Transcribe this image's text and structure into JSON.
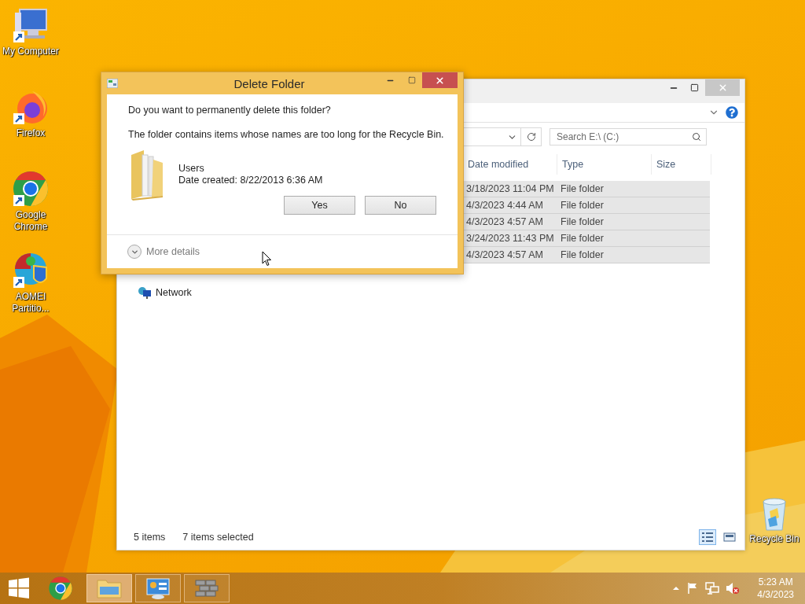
{
  "desktop_icons": [
    {
      "kind": "computer",
      "label": "My Computer"
    },
    {
      "kind": "firefox",
      "label": "Firefox"
    },
    {
      "kind": "chrome",
      "label": "Google Chrome"
    },
    {
      "kind": "aomei",
      "label": "AOMEI Partitio..."
    }
  ],
  "recycle_bin": {
    "label": "Recycle Bin"
  },
  "explorer": {
    "search": {
      "placeholder": "Search E:\\ (C:)"
    },
    "columns": [
      "Date modified",
      "Type",
      "Size"
    ],
    "rows": [
      {
        "date_modified": "3/18/2023 11:04 PM",
        "type": "File folder",
        "selected": true
      },
      {
        "date_modified": "4/3/2023 4:44 AM",
        "type": "File folder",
        "selected": true
      },
      {
        "date_modified": "4/3/2023 4:57 AM",
        "type": "File folder",
        "selected": true
      },
      {
        "date_modified": "3/24/2023 11:43 PM",
        "type": "File folder",
        "selected": true
      },
      {
        "date_modified": "4/3/2023 4:57 AM",
        "type": "File folder",
        "selected": true
      }
    ],
    "nav": [
      {
        "label": "Network"
      }
    ],
    "status": {
      "count": "5 items",
      "selection": "7 items selected"
    },
    "views": [
      {
        "kind": "details",
        "selected": true
      },
      {
        "kind": "tiles",
        "selected": false
      }
    ]
  },
  "dialog": {
    "title": "Delete Folder",
    "question": "Do you want to permanently delete this folder?",
    "message": "The folder contains items whose names are too long for the Recycle Bin.",
    "item": {
      "name": "Users",
      "detail": "Date created: 8/22/2013 6:36 AM"
    },
    "buttons": [
      "Yes",
      "No"
    ],
    "more_details": "More details"
  },
  "taskbar": {
    "apps": [
      {
        "kind": "chrome",
        "running": false,
        "selected": false
      },
      {
        "kind": "explorer",
        "running": true,
        "selected": true
      },
      {
        "kind": "control-panel",
        "running": true,
        "selected": false
      },
      {
        "kind": "firewall",
        "running": true,
        "selected": false
      }
    ],
    "clock": {
      "time": "5:23 AM",
      "date": "4/3/2023"
    }
  }
}
